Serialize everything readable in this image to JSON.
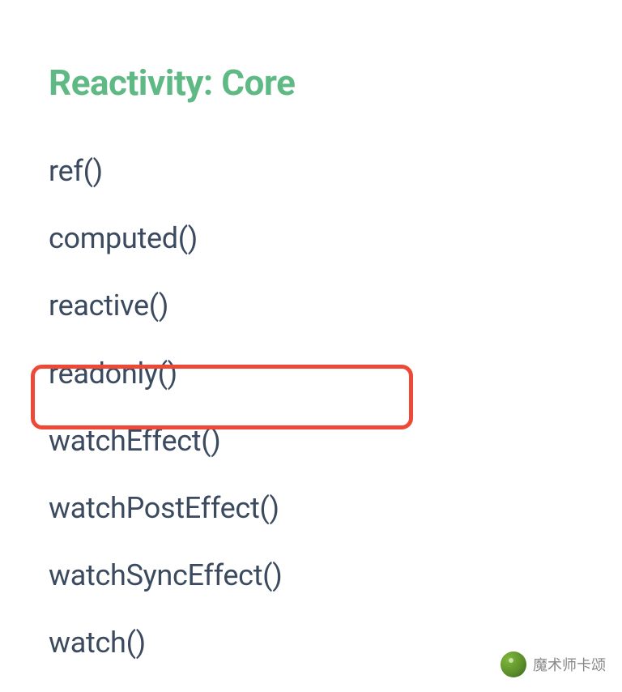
{
  "heading": "Reactivity: Core",
  "api_items": [
    {
      "label": "ref()",
      "highlighted": false
    },
    {
      "label": "computed()",
      "highlighted": false
    },
    {
      "label": "reactive()",
      "highlighted": false
    },
    {
      "label": "readonly()",
      "highlighted": false
    },
    {
      "label": "watchEffect()",
      "highlighted": true
    },
    {
      "label": "watchPostEffect()",
      "highlighted": false
    },
    {
      "label": "watchSyncEffect()",
      "highlighted": false
    },
    {
      "label": "watch()",
      "highlighted": false
    }
  ],
  "watermark": {
    "text": "魔术师卡颂"
  },
  "colors": {
    "heading": "#5fb984",
    "text": "#3b4a5e",
    "highlight_border": "#ee4937"
  }
}
